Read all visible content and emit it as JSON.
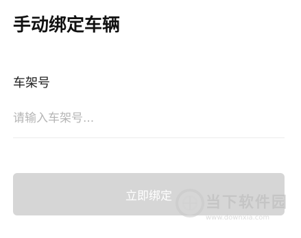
{
  "header": {
    "title": "手动绑定车辆"
  },
  "form": {
    "vin_label": "车架号",
    "vin_placeholder": "请输入车架号...",
    "vin_value": "",
    "submit_label": "立即绑定"
  },
  "watermark": {
    "brand": "当下软件园",
    "url": "www.downxia.com"
  },
  "colors": {
    "button_disabled_bg": "#d6d6d6",
    "placeholder": "#b5b5b5",
    "divider": "#ececec"
  }
}
